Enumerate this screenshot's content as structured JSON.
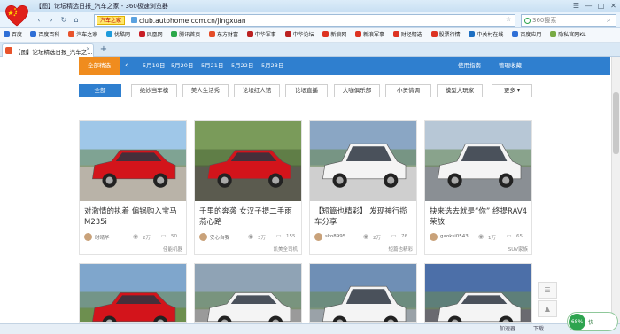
{
  "window": {
    "title": "【图】论坛精选日报_汽车之家 - 360极速浏览器",
    "controls": [
      "☰",
      "—",
      "□",
      "✕"
    ]
  },
  "nav": {
    "back": "‹",
    "forward": "›",
    "refresh": "↻",
    "home": "⌂",
    "site_badge": "汽车之家",
    "url": "club.autohome.com.cn/jingxuan",
    "search_placeholder": "360搜索"
  },
  "bookmarks": [
    {
      "label": "百度",
      "color": "#2f6fd6"
    },
    {
      "label": "百度百科",
      "color": "#2f6fd6"
    },
    {
      "label": "汽车之家",
      "color": "#e8532b"
    },
    {
      "label": "优酷网",
      "color": "#1f9bdb"
    },
    {
      "label": "凤凰网",
      "color": "#c81d25"
    },
    {
      "label": "腾讯首页",
      "color": "#2aa84a"
    },
    {
      "label": "东方财富",
      "color": "#e44c28"
    },
    {
      "label": "中华军事",
      "color": "#b22"
    },
    {
      "label": "中华论坛",
      "color": "#b22"
    },
    {
      "label": "新浪网",
      "color": "#d32"
    },
    {
      "label": "新浪军事",
      "color": "#d32"
    },
    {
      "label": "财经精选",
      "color": "#d32"
    },
    {
      "label": "股票行情",
      "color": "#d32"
    },
    {
      "label": "中关村在线",
      "color": "#1d6fc2"
    },
    {
      "label": "百度应用",
      "color": "#2f6fd6"
    },
    {
      "label": "隐私官网KL",
      "color": "#7a4"
    }
  ],
  "tab": {
    "label": "【图】论坛精选日报_汽车之...",
    "close": "✕",
    "new": "+"
  },
  "datebar": {
    "all": "全部精选",
    "prev": "‹",
    "dates": [
      "5月19日",
      "5月20日",
      "5月21日",
      "5月22日",
      "5月23日"
    ],
    "links": [
      "使用指南",
      "管理收藏"
    ]
  },
  "filters": {
    "items": [
      "全部",
      "绝妙当车模",
      "美人生活秀",
      "论坛红人馆",
      "论坛直播",
      "大咖俱乐部",
      "小贤情调",
      "模型大玩家"
    ],
    "more": "更多 ▾",
    "active_index": 0
  },
  "cards": [
    {
      "title": "对激情的执着 偏锅购入宝马M235i",
      "user": "时晴华",
      "views": "2万",
      "comments": "50",
      "tag": "佳能机器",
      "img": "red-bmw"
    },
    {
      "title": "千里的奔袭 女汉子提二手雨燕心路",
      "user": "安心自我",
      "views": "3万",
      "comments": "155",
      "tag": "凯美全司机",
      "img": "red-swift"
    },
    {
      "title": "【短篇也精彩】 发现神行揽车分享",
      "user": "sko8995",
      "views": "2万",
      "comments": "76",
      "tag": "短篇也精彩",
      "img": "white-rangerover"
    },
    {
      "title": "抉来选去就是“你” 终提RAV4荣放",
      "user": "gaoksi0543",
      "views": "1万",
      "comments": "65",
      "tag": "SUV家族",
      "img": "white-rav4"
    }
  ],
  "cards_row2": [
    "red-porsche",
    "white-vw",
    "white-nissan",
    "white-benz"
  ],
  "status": {
    "left": "加速器",
    "download": "下载",
    "speed": "快",
    "ball": "68%"
  },
  "float": [
    "☰",
    "▲"
  ]
}
